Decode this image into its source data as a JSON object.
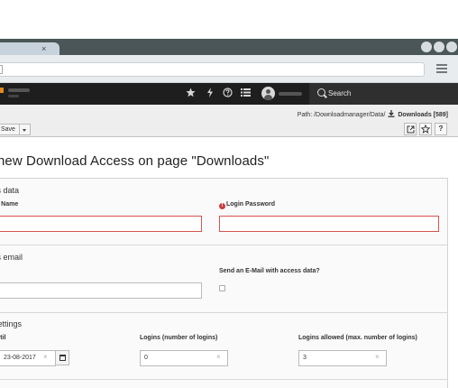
{
  "browser": {
    "tab_close": "×"
  },
  "topbar": {
    "icons": [
      "star-icon",
      "lightning-icon",
      "help-icon",
      "list-icon"
    ],
    "search_label": "Search"
  },
  "docheader": {
    "path_prefix": "Path: /Downloadmanager/Data/",
    "path_current": "Downloads [589]",
    "save_label": "Save",
    "buttons": [
      "open-new-window-icon",
      "bookmark-star-icon",
      "help-icon"
    ],
    "help_glyph": "?"
  },
  "page": {
    "title": "te new Download Access on page \"Downloads\""
  },
  "access_data": {
    "legend": "ss data",
    "login_name_label": "in Name",
    "login_password_label": "Login Password",
    "required_marker": "!"
  },
  "access_email": {
    "legend": "ss email",
    "send_email_label": "Send an E-Mail with access data?"
  },
  "settings": {
    "legend": "settings",
    "until_label": "ntil",
    "until_value": "23-08-2017",
    "logins_label": "Logins (number of logins)",
    "logins_value": "0",
    "logins_allowed_label": "Logins allowed (max. number of logins)",
    "logins_allowed_value": "3",
    "clear_glyph": "×"
  },
  "colors": {
    "topbar_bg": "#1e1e1e",
    "chrome_bg": "#4a5657",
    "error_border": "#d9534f",
    "required": "#c83c3c"
  }
}
